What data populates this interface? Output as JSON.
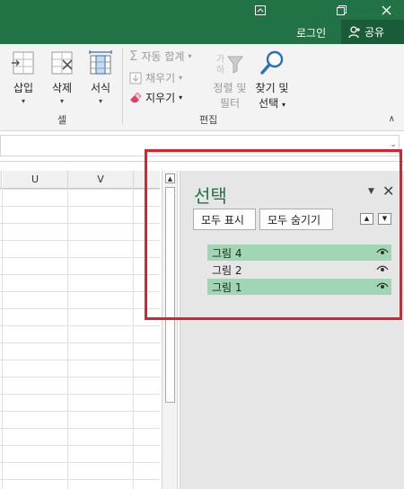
{
  "titlebar": {
    "icons": [
      "ribbon-display-options-icon",
      "restore-window-icon",
      "close-icon"
    ]
  },
  "account": {
    "login_label": "로그인",
    "share_label": "공유"
  },
  "ribbon": {
    "cells_group": {
      "label": "셀",
      "buttons": [
        {
          "label": "삽입",
          "icon": "insert-cells-icon"
        },
        {
          "label": "삭제",
          "icon": "delete-cells-icon"
        },
        {
          "label": "서식",
          "icon": "format-cells-icon"
        }
      ]
    },
    "editing_group": {
      "label": "편집",
      "autosum_label": "자동 합계",
      "fill_label": "채우기",
      "clear_label": "지우기",
      "sort_filter_line1": "정렬 및",
      "sort_filter_line2": "필터",
      "find_select_line1": "찾기 및",
      "find_select_line2": "선택"
    }
  },
  "grid": {
    "columns": [
      "U",
      "V"
    ]
  },
  "selection_pane": {
    "title": "선택",
    "show_all_label": "모두 표시",
    "hide_all_label": "모두 숨기기",
    "items": [
      {
        "label": "그림 4",
        "selected": true
      },
      {
        "label": "그림 2",
        "selected": false
      },
      {
        "label": "그림 1",
        "selected": true
      }
    ]
  },
  "colors": {
    "brand": "#217346",
    "selection_highlight": "#a0d6b4",
    "annotation_red": "#e0202a"
  }
}
